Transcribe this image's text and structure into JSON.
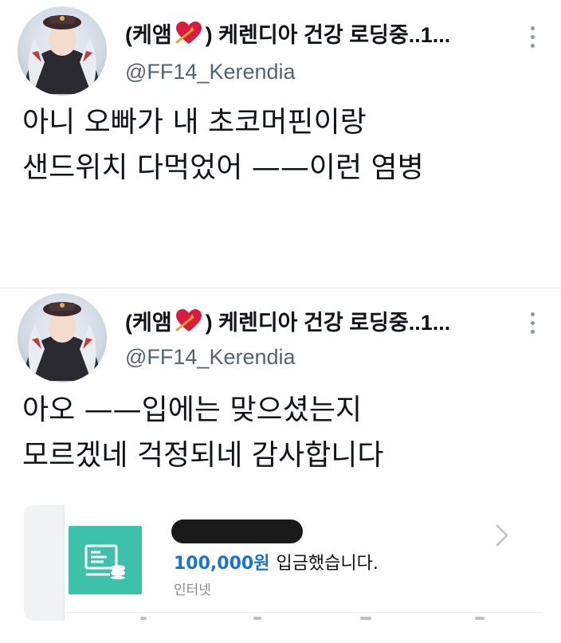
{
  "tweets": [
    {
      "display_name": "(케앰",
      "display_name_rest": ") 케렌디아 건강 로딩중..1...",
      "handle": "@FF14_Kerendia",
      "lines": [
        "아니 오빠가 내 초코머핀이랑",
        "샌드위치 다먹었어 ——이런 염병"
      ]
    },
    {
      "display_name": "(케앰",
      "display_name_rest": ") 케렌디아 건강 로딩중..1...",
      "handle": "@FF14_Kerendia",
      "lines": [
        "아오 ——입에는 맞으셨는지",
        "모르겠네 걱정되네 감사합니다"
      ]
    }
  ],
  "notification": {
    "amount": "100,000원",
    "message": "입금했습니다.",
    "source": "인터넷",
    "icon": "deposit-icon"
  },
  "colors": {
    "accent_teal": "#3ec1aa",
    "amount_blue": "#1a73d1",
    "heart": "#d81b3f"
  }
}
